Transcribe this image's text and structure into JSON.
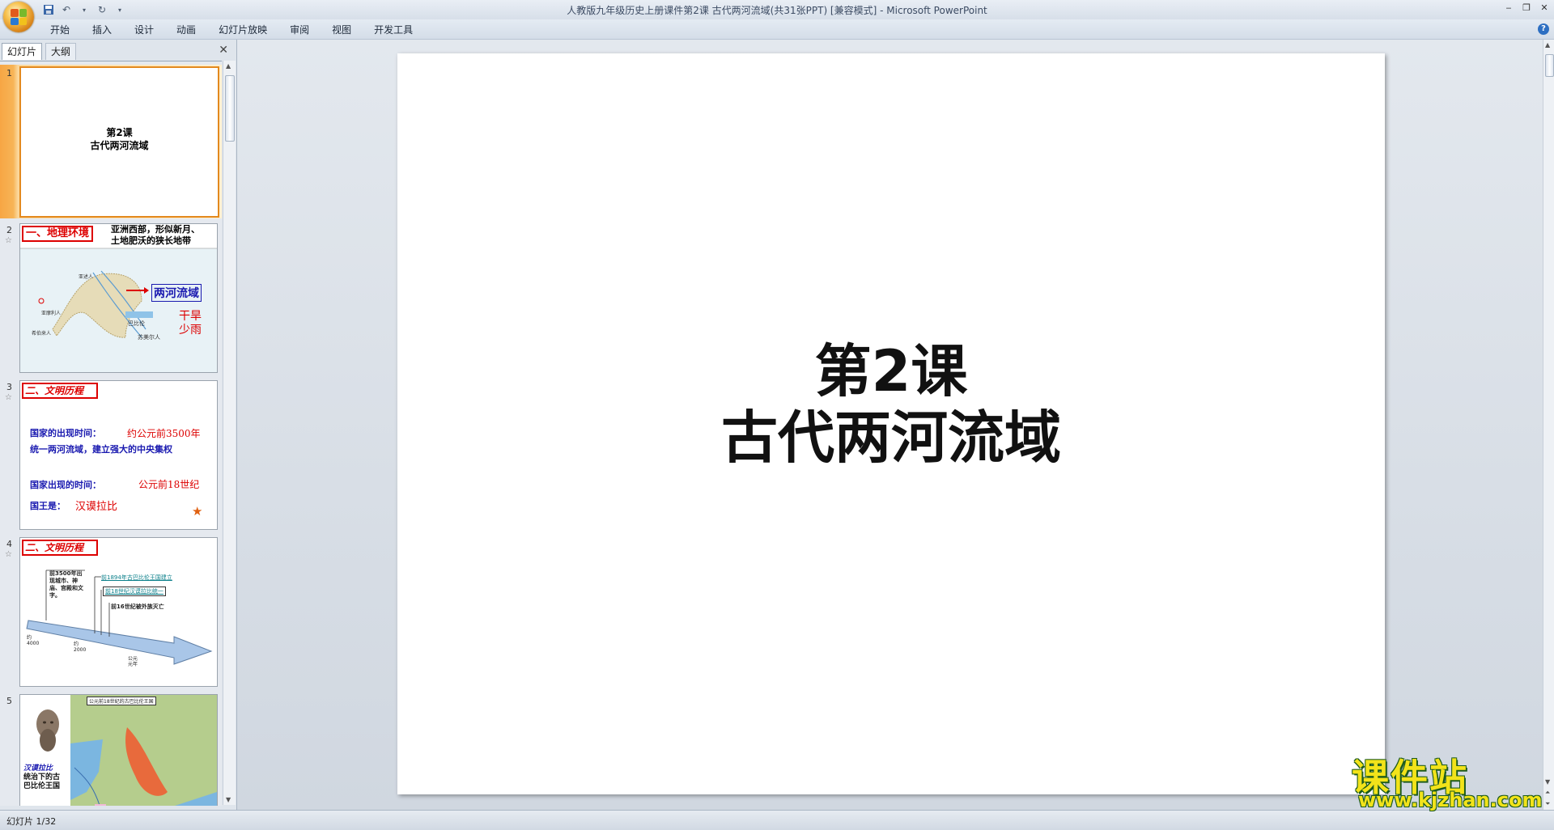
{
  "window": {
    "title": "人教版九年级历史上册课件第2课 古代两河流域(共31张PPT) [兼容模式] - Microsoft PowerPoint"
  },
  "ribbon": {
    "tabs": [
      "开始",
      "插入",
      "设计",
      "动画",
      "幻灯片放映",
      "审阅",
      "视图",
      "开发工具"
    ]
  },
  "left_panel": {
    "tab_slides": "幻灯片",
    "tab_outline": "大纲",
    "close": "✕"
  },
  "thumbnails": [
    {
      "num": "1",
      "line1": "第2课",
      "line2": "古代两河流域"
    },
    {
      "num": "2",
      "heading": "一、地理环境",
      "desc1": "亚洲西部，形似新月、",
      "desc2": "土地肥沃的狭长地带",
      "label": "两河流域",
      "side1": "干旱",
      "side2": "少雨",
      "place1": "巴比伦",
      "place2": "苏美尔人",
      "place3": "亚述人",
      "place4": "亚摩利人",
      "place5": "希伯来人"
    },
    {
      "num": "3",
      "heading": "二、文明历程",
      "row1_label": "国家的出现时间：",
      "row1_val": "约公元前3500年",
      "row2": "统一两河流域，建立强大的中央集权",
      "row3_label": "国家出现的时间：",
      "row3_val": "公元前18世纪",
      "row4_label": "国王是：",
      "row4_val": "汉谟拉比"
    },
    {
      "num": "4",
      "heading": "二、文明历程",
      "note1": "前3500年出现城市、神庙、宫殿和文字。",
      "note2": "前1894年古巴比伦王国建立",
      "note3": "前18世纪汉谟拉比统一",
      "note4": "前16世纪被外族灭亡",
      "tick1": "约4000",
      "tick2": "约2000",
      "tick3": "公元元年"
    },
    {
      "num": "5",
      "caption1": "汉谟拉比",
      "caption2": "统治下的古",
      "caption3": "巴比伦王国",
      "map_title": "公元前18世纪的古巴比伦王国"
    }
  ],
  "main_slide": {
    "line1": "第2课",
    "line2": "古代两河流域"
  },
  "status": {
    "text": "幻灯片 1/32"
  },
  "watermark": {
    "main": "课件站",
    "url": "www.kjzhan.com"
  },
  "colors": {
    "selection": "#f7a644",
    "red_heading": "#dd0000",
    "blue_text": "#1a1ab0"
  }
}
